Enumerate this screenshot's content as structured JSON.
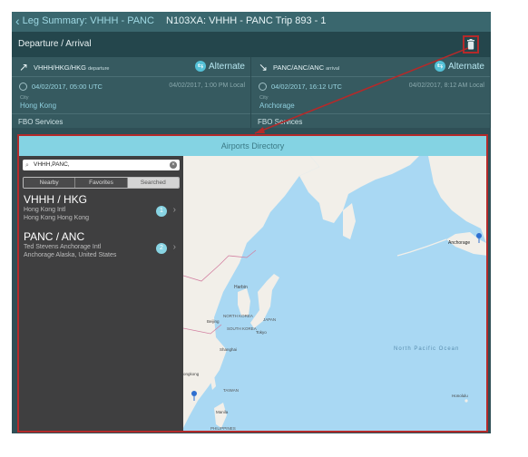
{
  "nav": {
    "back_label": "Leg Summary: VHHH - PANC",
    "title": "N103XA: VHHH - PANC  Trip 893 - 1"
  },
  "section": {
    "label": "Departure / Arrival"
  },
  "departure": {
    "code": "VHHH/HKG/HKG",
    "tag": "departure",
    "alternate": "Alternate",
    "utc": "04/02/2017, 05:00  UTC",
    "local": "04/02/2017, 1:00 PM  Local",
    "city_label": "City",
    "city": "Hong Kong",
    "fbo": "FBO Services"
  },
  "arrival": {
    "code": "PANC/ANC/ANC",
    "tag": "arrival",
    "alternate": "Alternate",
    "utc": "04/02/2017, 16:12  UTC",
    "local": "04/02/2017, 8:12 AM  Local",
    "city_label": "City",
    "city": "Anchorage",
    "fbo": "FBO Services"
  },
  "directory": {
    "title": "Airports Directory",
    "search_value": "VHHH,PANC,",
    "tabs": [
      "Nearby",
      "Favorites",
      "Searched"
    ],
    "selected_tab": "Searched",
    "airports": [
      {
        "name": "VHHH / HKG",
        "line1": "Hong Kong Intl",
        "line2": "Hong Kong Hong Kong",
        "badge": "1"
      },
      {
        "name": "PANC / ANC",
        "line1": "Ted Stevens Anchorage Intl",
        "line2": "Anchorage Alaska, United States",
        "badge": "2"
      }
    ]
  },
  "map": {
    "labels": {
      "anchorage": "Anchorage",
      "harbin": "Harbin",
      "north_korea": "NORTH KOREA",
      "beijing": "Beijing",
      "south_korea": "SOUTH KOREA",
      "japan": "JAPAN",
      "tokyo": "Tokyo",
      "shanghai": "Shanghai",
      "pacific": "North Pacific Ocean",
      "taiwan": "TAIWAN",
      "hongkong": "ongkong",
      "manila": "Manila",
      "philippines": "PHILIPPINES",
      "honolulu": "Honolulu"
    }
  },
  "colors": {
    "accent": "#54c1d7",
    "callout": "#b42a2a",
    "land": "#f2efe9",
    "water": "#a9d8f3"
  }
}
